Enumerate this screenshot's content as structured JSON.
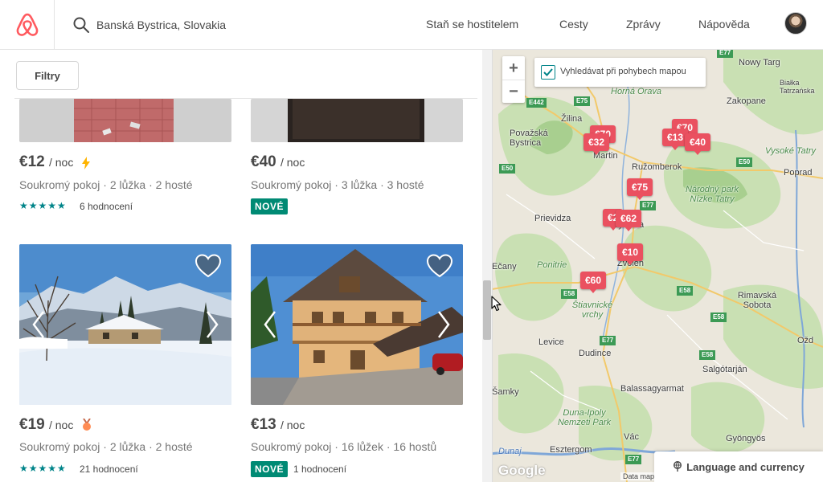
{
  "header": {
    "search_value": "Banská Bystrica, Slovakia",
    "nav": [
      "Staň se hostitelem",
      "Cesty",
      "Zprávy",
      "Nápověda"
    ]
  },
  "filters": {
    "label": "Filtry"
  },
  "listings": [
    {
      "price": "€12",
      "per": "/ noc",
      "info": "Soukromý pokoj · 2 lůžka · 2 hosté",
      "stars": "★★★★★",
      "reviews": "6 hodnocení"
    },
    {
      "price": "€40",
      "per": "/ noc",
      "info": "Soukromý pokoj · 3 lůžka · 3 hosté",
      "badge": "NOVÉ"
    },
    {
      "price": "€19",
      "per": "/ noc",
      "info": "Soukromý pokoj · 2 lůžka · 2 hosté",
      "stars": "★★★★★",
      "reviews": "21 hodnocení"
    },
    {
      "price": "€13",
      "per": "/ noc",
      "info": "Soukromý pokoj · 16 lůžek · 16 hostů",
      "badge": "NOVÉ",
      "reviews": "1 hodnocení"
    }
  ],
  "map": {
    "search_when_moving": "Vyhledávat při pohybech mapou",
    "zoom_in": "+",
    "zoom_out": "−",
    "pins": [
      "€32",
      "€13",
      "€40",
      "€75",
      "€2",
      "€62",
      "€10",
      "€60",
      "€70"
    ],
    "places": [
      "Nowy Targ",
      "Białka Tatrzańska",
      "Horná Orava",
      "Zakopane",
      "Žilina",
      "Považská Bystrica",
      "Martin",
      "Ružomberok",
      "Vysoké Tatry",
      "Poprad",
      "Národný park Nízke Tatry",
      "Prievidza",
      "Bystrica",
      "Zvolen",
      "Ponitrie",
      "Štiavnické vrchy",
      "Rimavská Sobota",
      "Levice",
      "Dudince",
      "Salgótarján",
      "Balassagyarmat",
      "Duna-Ipoly Nemzeti Park",
      "Vác",
      "Gyöngyös",
      "Esztergom",
      "Ožd",
      "Šamky",
      "Ečany",
      "Dunaj"
    ],
    "roads": [
      "E77",
      "E442",
      "E75",
      "E50",
      "E50",
      "E77",
      "E58",
      "E58",
      "E58",
      "E58",
      "E77",
      "E77"
    ],
    "google": "Google",
    "attribution": "Data map",
    "language_currency": "Language and currency"
  }
}
